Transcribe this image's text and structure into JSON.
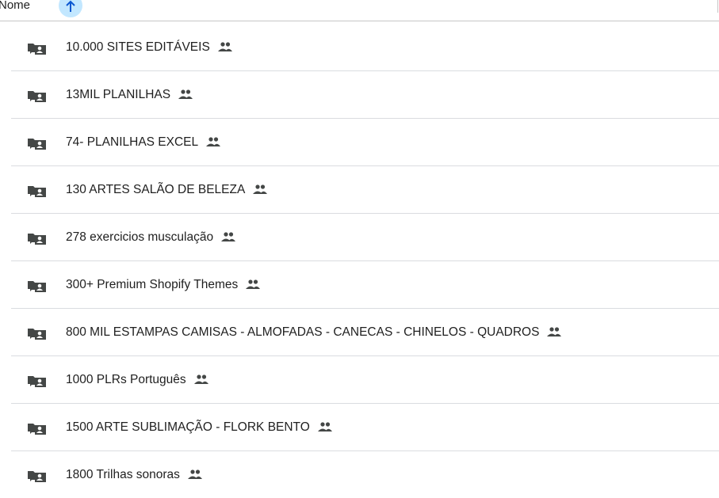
{
  "header": {
    "name_label": "Nome",
    "sort_icon": "arrow-up-icon"
  },
  "rows": [
    {
      "name": "10.000 SITES EDITÁVEIS",
      "icon": "shared-folder-icon",
      "shared": true
    },
    {
      "name": "13MIL PLANILHAS",
      "icon": "shared-folder-icon",
      "shared": true
    },
    {
      "name": "74- PLANILHAS EXCEL",
      "icon": "shared-folder-icon",
      "shared": true
    },
    {
      "name": "130 ARTES SALÃO DE BELEZA",
      "icon": "shared-folder-icon",
      "shared": true
    },
    {
      "name": "278 exercicios musculação",
      "icon": "shared-folder-icon",
      "shared": true
    },
    {
      "name": "300+ Premium Shopify Themes",
      "icon": "shared-folder-icon",
      "shared": true
    },
    {
      "name": "800 MIL ESTAMPAS CAMISAS - ALMOFADAS - CANECAS  - CHINELOS - QUADROS",
      "icon": "shared-folder-icon",
      "shared": true
    },
    {
      "name": "1000 PLRs Português",
      "icon": "shared-folder-icon",
      "shared": true
    },
    {
      "name": "1500 ARTE SUBLIMAÇÃO - FLORK BENTO",
      "icon": "shared-folder-icon",
      "shared": true
    },
    {
      "name": "1800 Trilhas sonoras",
      "icon": "shared-folder-icon",
      "shared": true
    }
  ],
  "colors": {
    "icon": "#444746",
    "text": "#1f1f1f",
    "sort_bg": "#c2e7ff",
    "divider": "#dadce0"
  }
}
